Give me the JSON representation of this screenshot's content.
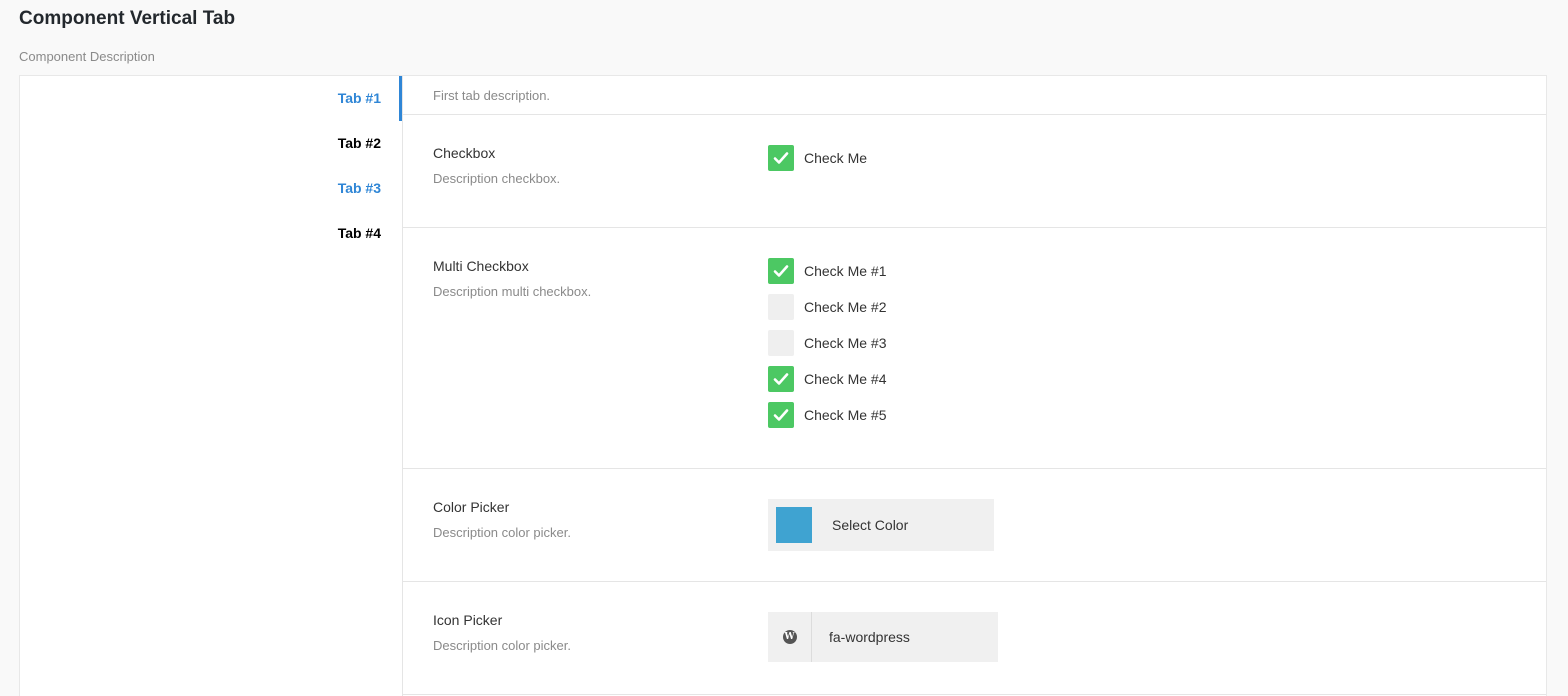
{
  "page": {
    "title": "Component Vertical Tab",
    "description": "Component Description"
  },
  "tabs": [
    {
      "label": "Tab #1",
      "active": true,
      "color": "#2f86d6"
    },
    {
      "label": "Tab #2",
      "active": false,
      "color": "#000000"
    },
    {
      "label": "Tab #3",
      "active": false,
      "color": "#2f86d6"
    },
    {
      "label": "Tab #4",
      "active": false,
      "color": "#000000"
    }
  ],
  "tab_content": {
    "description": "First tab description.",
    "checkbox": {
      "title": "Checkbox",
      "description": "Description checkbox.",
      "label": "Check Me",
      "checked": true
    },
    "multi_checkbox": {
      "title": "Multi Checkbox",
      "description": "Description multi checkbox.",
      "options": [
        {
          "label": "Check Me #1",
          "checked": true
        },
        {
          "label": "Check Me #2",
          "checked": false
        },
        {
          "label": "Check Me #3",
          "checked": false
        },
        {
          "label": "Check Me #4",
          "checked": true
        },
        {
          "label": "Check Me #5",
          "checked": true
        }
      ]
    },
    "color_picker": {
      "title": "Color Picker",
      "description": "Description color picker.",
      "button_label": "Select Color",
      "value": "#3fa3d1"
    },
    "icon_picker": {
      "title": "Icon Picker",
      "description": "Description color picker.",
      "value": "fa-wordpress",
      "icon": "wordpress-icon"
    }
  },
  "colors": {
    "accent": "#2f86d6",
    "checked": "#4cc863",
    "unchecked": "#efefef"
  }
}
